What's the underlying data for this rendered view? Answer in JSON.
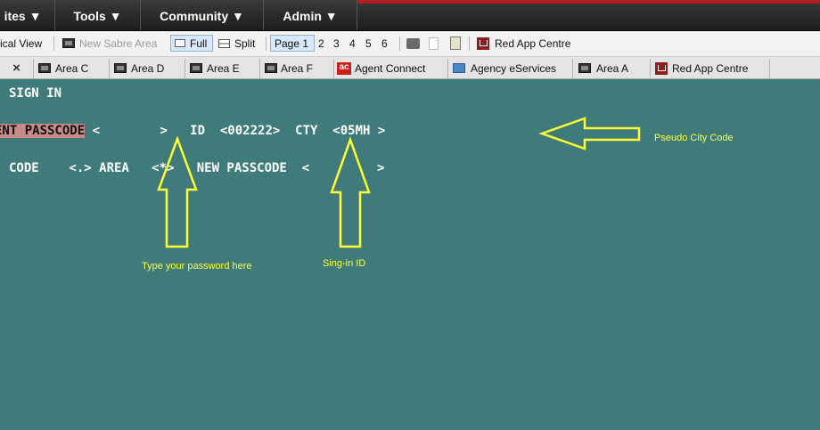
{
  "menubar": {
    "items": [
      {
        "label": "ites ▼"
      },
      {
        "label": "Tools ▼"
      },
      {
        "label": "Community ▼"
      },
      {
        "label": "Admin ▼"
      }
    ]
  },
  "toolbar": {
    "view_label": "ical View",
    "new_area_label": "New Sabre Area",
    "full_label": "Full",
    "split_label": "Split",
    "page_label": "Page 1",
    "pages": [
      "2",
      "3",
      "4",
      "5",
      "6"
    ],
    "red_app_label": "Red App Centre"
  },
  "tabs": {
    "close_glyph": "×",
    "items": [
      {
        "label": "Area C",
        "icon": "terminal-icon"
      },
      {
        "label": "Area D",
        "icon": "terminal-icon"
      },
      {
        "label": "Area E",
        "icon": "terminal-icon"
      },
      {
        "label": "Area F",
        "icon": "terminal-icon"
      },
      {
        "label": "Agent Connect",
        "icon": "ac-icon",
        "icon_text": "ac"
      },
      {
        "label": "Agency eServices",
        "icon": "web-icon"
      },
      {
        "label": "Area A",
        "icon": "terminal-icon"
      },
      {
        "label": "Red App Centre",
        "icon": "cart-icon"
      }
    ]
  },
  "terminal": {
    "line1": "SIGN IN",
    "passcode_label": "ENT PASSCODE",
    "line2_rest": " <        >   ID  <002222>  CTY  <05MH >",
    "line3": "CODE    <.> AREA   <*>   NEW PASSCODE  <         >"
  },
  "annotations": {
    "pcc": "Pseudo City Code",
    "password": "Type your password here",
    "signin": "Sing-in ID"
  },
  "colors": {
    "terminal_bg": "#3f7b7b",
    "annotation": "#ffff33",
    "highlight": "#c98a8a"
  }
}
